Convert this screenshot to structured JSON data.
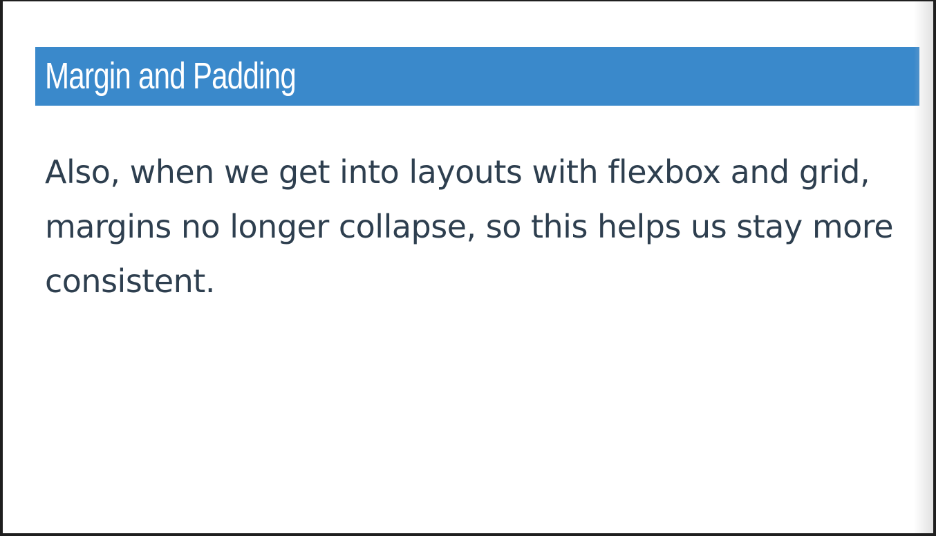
{
  "slide": {
    "title": "Margin and Padding",
    "body": "Also, when we get into layouts with flexbox and grid, margins no longer collapse, so this helps us stay more consistent."
  },
  "colors": {
    "title_bar": "#3a89cb",
    "title_text": "#ffffff",
    "body_text": "#2e3f4f",
    "background": "#ffffff"
  }
}
